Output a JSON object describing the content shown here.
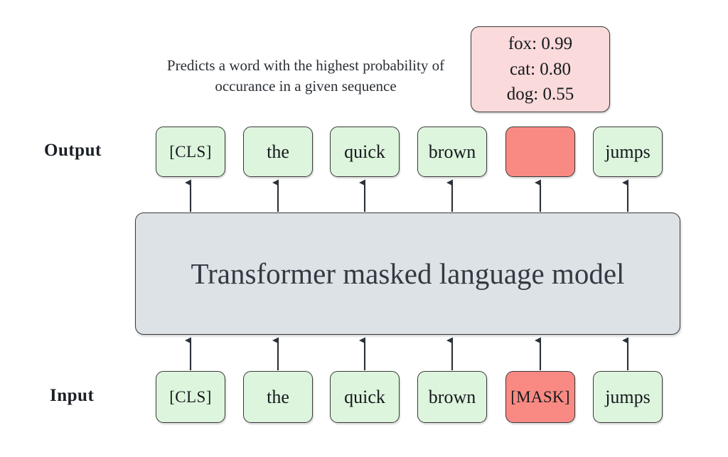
{
  "diagram": {
    "title": "Transformer masked language model",
    "caption": "Predicts a word with the highest probability of occurance in a given sequence",
    "rows": {
      "output_label": "Output",
      "input_label": "Input"
    },
    "output_tokens": [
      {
        "text": "[CLS]",
        "style": "small-caps",
        "masked": false
      },
      {
        "text": "the",
        "style": "normal",
        "masked": false
      },
      {
        "text": "quick",
        "style": "normal",
        "masked": false
      },
      {
        "text": "brown",
        "style": "normal",
        "masked": false
      },
      {
        "text": "",
        "style": "normal",
        "masked": true
      },
      {
        "text": "jumps",
        "style": "normal",
        "masked": false
      }
    ],
    "input_tokens": [
      {
        "text": "[CLS]",
        "style": "small-caps",
        "masked": false
      },
      {
        "text": "the",
        "style": "normal",
        "masked": false
      },
      {
        "text": "quick",
        "style": "normal",
        "masked": false
      },
      {
        "text": "brown",
        "style": "normal",
        "masked": false
      },
      {
        "text": "[MASK]",
        "style": "allcaps",
        "masked": true
      },
      {
        "text": "jumps",
        "style": "normal",
        "masked": false
      }
    ],
    "predictions": [
      {
        "word": "fox",
        "probability": "0.99",
        "line": "fox: 0.99"
      },
      {
        "word": "cat",
        "probability": "0.80",
        "line": "cat: 0.80"
      },
      {
        "word": "dog",
        "probability": "0.55",
        "line": "dog: 0.55"
      }
    ],
    "colors": {
      "token_green": "#ddf5dd",
      "token_red": "#f98a83",
      "prob_box_pink": "#fadada",
      "transformer_grey": "#dde2e6",
      "stroke": "#3a3a3a",
      "text": "#15191d",
      "background": "#ffffff"
    }
  }
}
